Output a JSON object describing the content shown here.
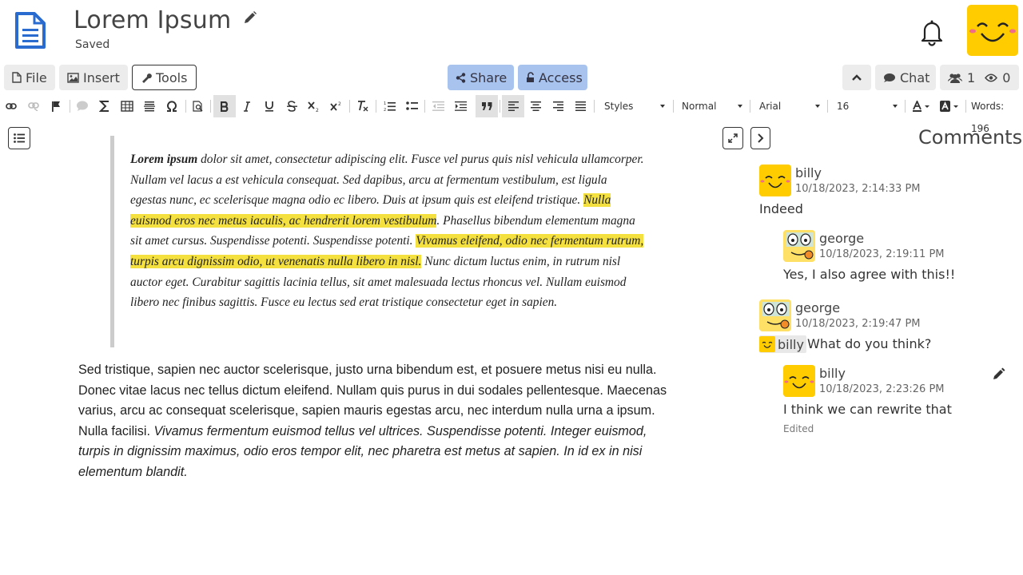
{
  "header": {
    "title": "Lorem Ipsum",
    "status": "Saved"
  },
  "menubar": {
    "file": "File",
    "insert": "Insert",
    "tools": "Tools",
    "share": "Share",
    "access": "Access",
    "chat": "Chat",
    "users_count": "1",
    "viewers_count": "0"
  },
  "toolbar": {
    "styles": "Styles",
    "format": "Normal",
    "font": "Arial",
    "size": "16",
    "word_count": "Words: 196"
  },
  "document": {
    "quote_bold": "Lorem ipsum",
    "quote_1": " dolor sit amet, consectetur adipiscing elit. Fusce vel purus quis nisl vehicula ullamcorper. Nullam vel lacus a est vehicula consequat. Sed dapibus, arcu at fermentum vestibulum, est ligula egestas nunc, ec scelerisque magna odio ec libero. Duis at ipsum quis est eleifend tristique. ",
    "quote_hl_1": "Nulla euismod eros nec metus iaculis, ac hendrerit lorem vestibulum",
    "quote_2": ". Phasellus bibendum elementum magna sit amet cursus. Suspendisse potenti. Suspendisse potenti. ",
    "quote_hl_2": "Vivamus eleifend, odio nec fermentum rutrum, turpis arcu dignissim odio, ut venenatis nulla libero in nisl.",
    "quote_3": " Nunc dictum luctus enim, in rutrum nisl auctor eget. Curabitur sagittis lacinia tellus, sit amet malesuada lectus rhoncus vel. Nullam euismod libero nec finibus sagittis. Fusce eu lectus sed erat tristique consectetur eget in sapien.",
    "para_normal": "Sed tristique, sapien nec auctor scelerisque, justo urna bibendum est, et posuere metus nisi eu nulla. Donec vitae lacus nec tellus dictum eleifend. Nullam quis purus in dui sodales pellentesque. Maecenas varius, arcu ac consequat scelerisque, sapien mauris egestas arcu, nec interdum nulla urna a ipsum. Nulla facilisi. ",
    "para_italic": "Vivamus fermentum euismod tellus vel ultrices. Suspendisse potenti. Integer euismod, turpis in dignissim maximus, odio eros tempor elit, nec pharetra est metus at sapien. In id ex in nisi elementum blandit."
  },
  "comments": {
    "title": "Comments",
    "items": [
      {
        "author": "billy",
        "date": "10/18/2023, 2:14:33 PM",
        "text": "Indeed"
      },
      {
        "author": "george",
        "date": "10/18/2023, 2:19:11 PM",
        "text": "Yes, I also agree with this!!"
      },
      {
        "author": "george",
        "date": "10/18/2023, 2:19:47 PM",
        "mention": "billy",
        "text": "What do you think?"
      },
      {
        "author": "billy",
        "date": "10/18/2023, 2:23:26 PM",
        "text": "I think we can rewrite that",
        "edited": "Edited"
      }
    ]
  },
  "colors": {
    "accent_blue": "#a7c3ee",
    "doc_icon": "#2a6bcf",
    "highlight": "#f4e13f",
    "avatar": "#ffcc00"
  },
  "icons": {
    "document": "file-text-icon",
    "edit": "pencil-icon",
    "notifications": "bell-icon",
    "outline": "list-icon",
    "expand": "expand-icon",
    "next": "chevron-right-icon"
  }
}
